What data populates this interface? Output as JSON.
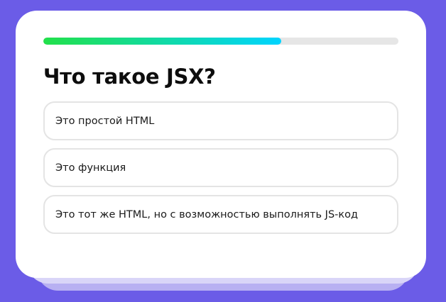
{
  "quiz": {
    "progress": 0.67,
    "question": "Что такое JSX?",
    "answers": [
      "Это простой HTML",
      "Это функция",
      "Это тот же HTML, но с возможностью выполнять JS-код"
    ]
  },
  "colors": {
    "background": "#6b5ce7",
    "card": "#ffffff",
    "progress_start": "#22e04a",
    "progress_end": "#00d4ff",
    "progress_track": "#e6e6e6",
    "answer_border": "#e4e4e4"
  }
}
